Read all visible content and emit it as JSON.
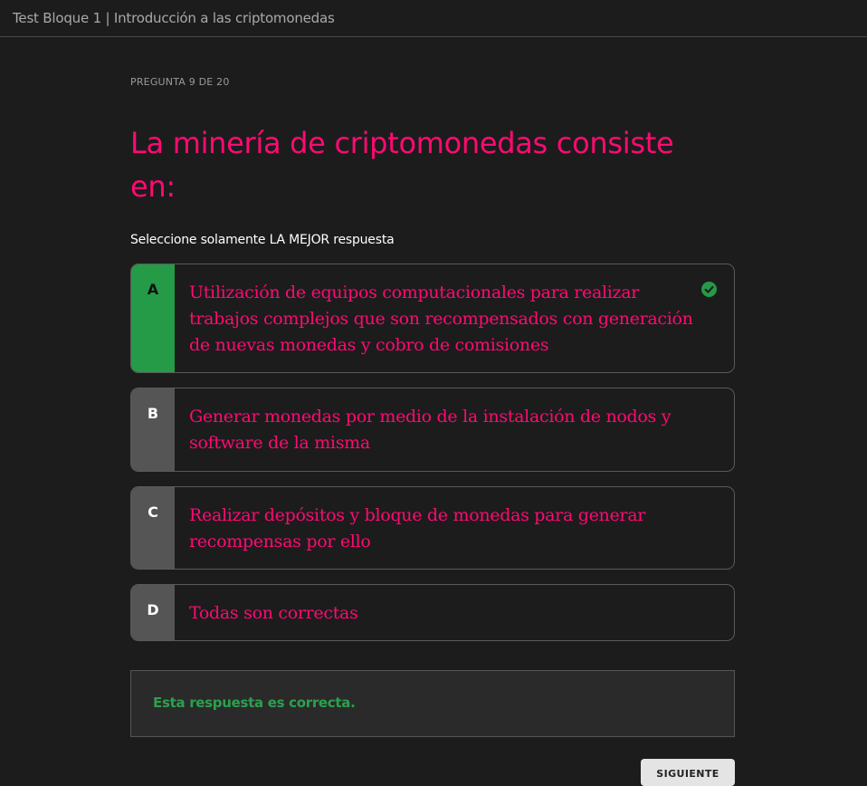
{
  "window": {
    "title": "Test Bloque 1 | Introducción a las criptomonedas"
  },
  "quiz": {
    "counter": "PREGUNTA 9 DE 20",
    "question": "La minería de criptomonedas consiste en:",
    "instruction": "Seleccione solamente LA MEJOR respuesta",
    "options": [
      {
        "letter": "A",
        "text": "Utilización de equipos computacionales para realizar trabajos complejos que son recompensados con generación de nuevas monedas y cobro de comisiones",
        "correct": true
      },
      {
        "letter": "B",
        "text": "Generar monedas por medio de la instalación de nodos y software de la misma",
        "correct": false
      },
      {
        "letter": "C",
        "text": "Realizar depósitos y bloque de monedas para generar recompensas por ello",
        "correct": false
      },
      {
        "letter": "D",
        "text": "Todas son correctas",
        "correct": false
      }
    ],
    "feedback": "Esta respuesta es correcta.",
    "next_label": "SIGUIENTE"
  },
  "colors": {
    "accent": "#ff0a73",
    "correct": "#259a47",
    "background": "#1c1c1c"
  },
  "icons": {
    "correct_mark": "check-circle-icon"
  }
}
